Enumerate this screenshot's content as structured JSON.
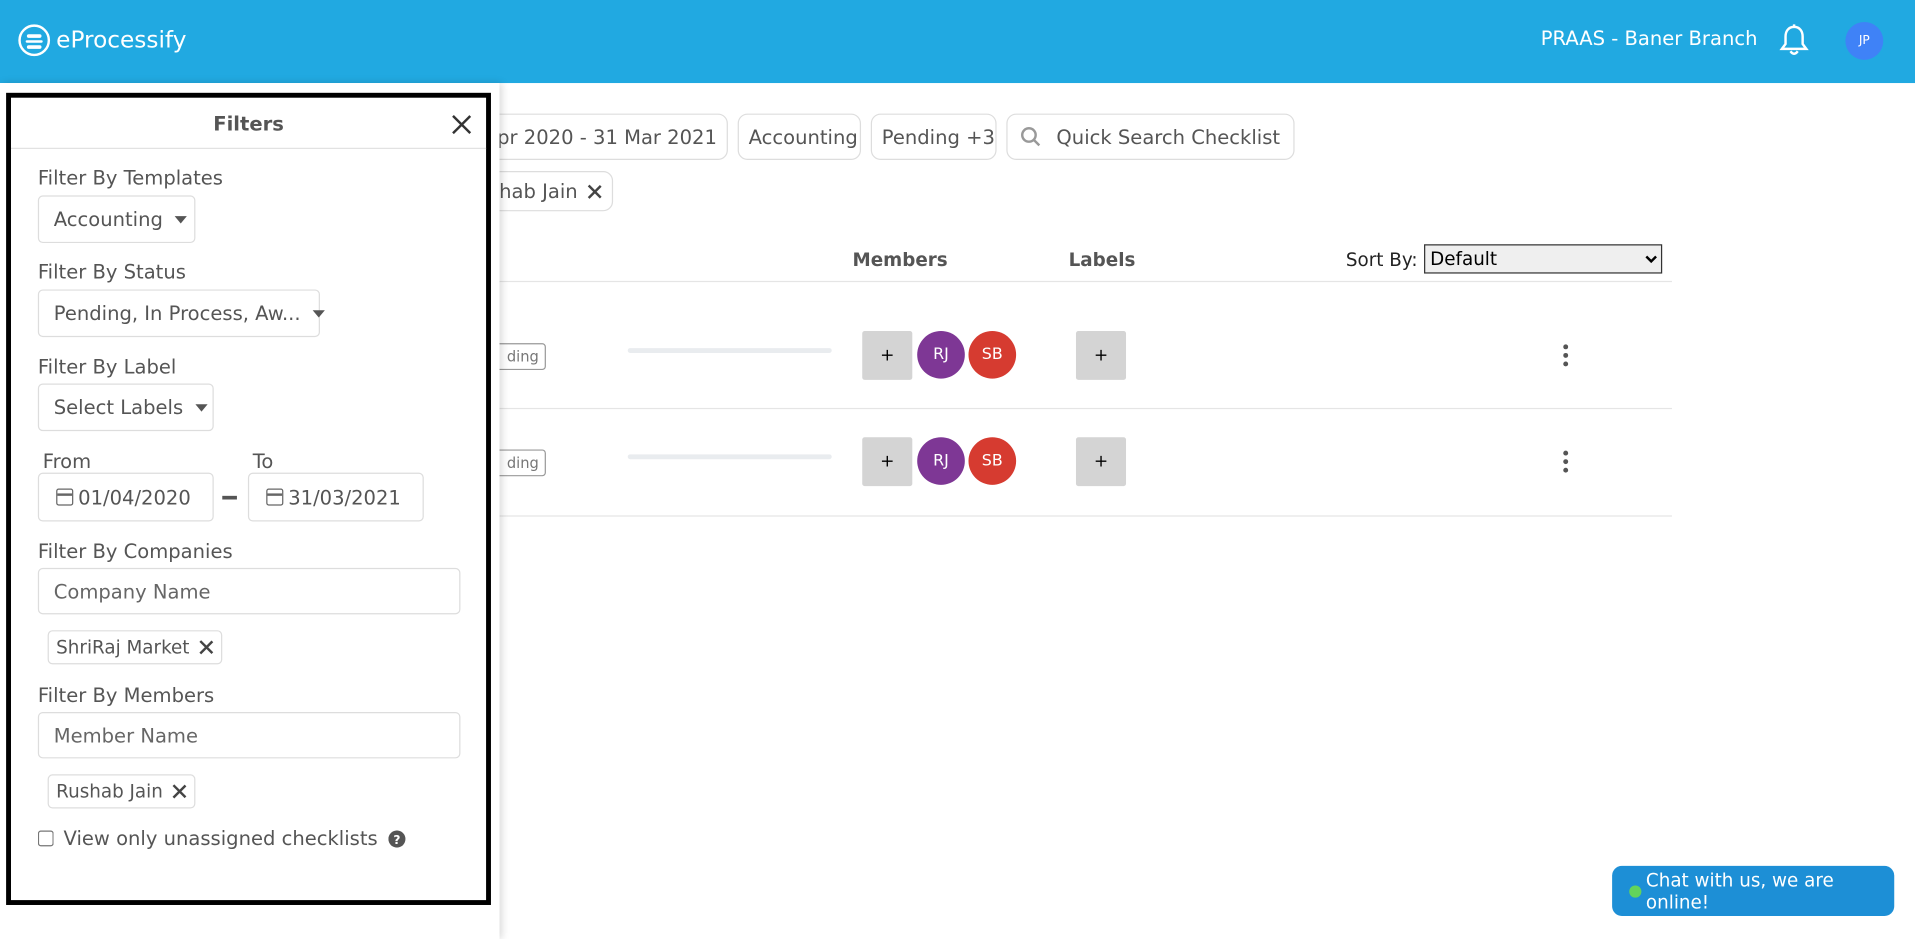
{
  "app": {
    "name": "eProcessify",
    "branch": "PRAAS - Baner Branch",
    "user_initials": "JP"
  },
  "filter_chips": {
    "date_range": "Apr 2020 - 31 Mar 2021",
    "template": "Accounting",
    "status": "Pending +3",
    "search_placeholder": "Quick Search Checklist",
    "member_chip": "hab Jain"
  },
  "table": {
    "headers": {
      "members": "Members",
      "labels": "Labels"
    },
    "sort_label": "Sort By:",
    "sort_value": "Default",
    "rows": [
      {
        "badge": "ding",
        "add": "+",
        "members": [
          "RJ",
          "SB"
        ],
        "label_add": "+"
      },
      {
        "badge": "ding",
        "add": "+",
        "members": [
          "RJ",
          "SB"
        ],
        "label_add": "+"
      }
    ]
  },
  "filters": {
    "title": "Filters",
    "templates_label": "Filter By Templates",
    "templates_value": "Accounting",
    "status_label": "Filter By Status",
    "status_value": "Pending, In Process, Aw...",
    "label_label": "Filter By Label",
    "label_value": "Select Labels",
    "from_label": "From",
    "to_label": "To",
    "from_date": "01/04/2020",
    "to_date": "31/03/2021",
    "companies_label": "Filter By Companies",
    "companies_placeholder": "Company Name",
    "company_tag": "ShriRaj Market",
    "members_label": "Filter By Members",
    "members_placeholder": "Member Name",
    "member_tag": "Rushab Jain",
    "unassigned_label": "View only unassigned checklists"
  },
  "chat": {
    "text": "Chat with us, we are online!"
  },
  "colors": {
    "topbar": "#21a9e1",
    "rj": "#7e3795",
    "sb": "#d63b30",
    "avatar": "#3f82f7",
    "chat": "#1d8fd6"
  }
}
